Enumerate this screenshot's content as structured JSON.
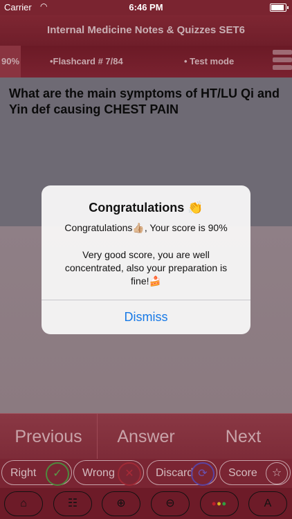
{
  "status_bar": {
    "carrier": "Carrier",
    "wifi_icon": "wifi-icon",
    "time": "6:46 PM",
    "battery_icon": "battery-icon"
  },
  "header": {
    "title": "Internal Medicine  Notes & Quizzes SET6"
  },
  "info_bar": {
    "score": "90%",
    "flashcard": "•Flashcard #  7/84",
    "mode": "• Test mode",
    "menu_icon": "menu-icon"
  },
  "question": {
    "text": "What are the main symptoms of HT/LU Qi and Yin def causing CHEST PAIN"
  },
  "alert": {
    "title": "Congratulations 👏",
    "message_line1": "Congratulations👍🏼, Your score is 90%",
    "message_line2": "Very good score, you are well concentrated, also your preparation is fine!🍰",
    "dismiss_label": "Dismiss"
  },
  "nav": {
    "previous_label": "Previous",
    "answer_label": "Answer",
    "next_label": "Next"
  },
  "marks": {
    "right_label": "Right",
    "right_icon": "✓",
    "wrong_label": "Wrong",
    "wrong_icon": "✕",
    "discard_label": "Discard",
    "discard_icon": "⟳",
    "score_label": "Score",
    "score_icon": "☆"
  },
  "toolbar": {
    "home_icon": "⌂",
    "tree_icon": "☷",
    "zoom_in_icon": "⊕",
    "zoom_out_icon": "⊖",
    "dots_icon": "•••",
    "up_icon": "A"
  },
  "colors": {
    "header": "#7e2632",
    "accent_link": "#1779e6",
    "right": "#5a9a48",
    "wrong": "#a82a36",
    "discard": "#6a52b0"
  }
}
